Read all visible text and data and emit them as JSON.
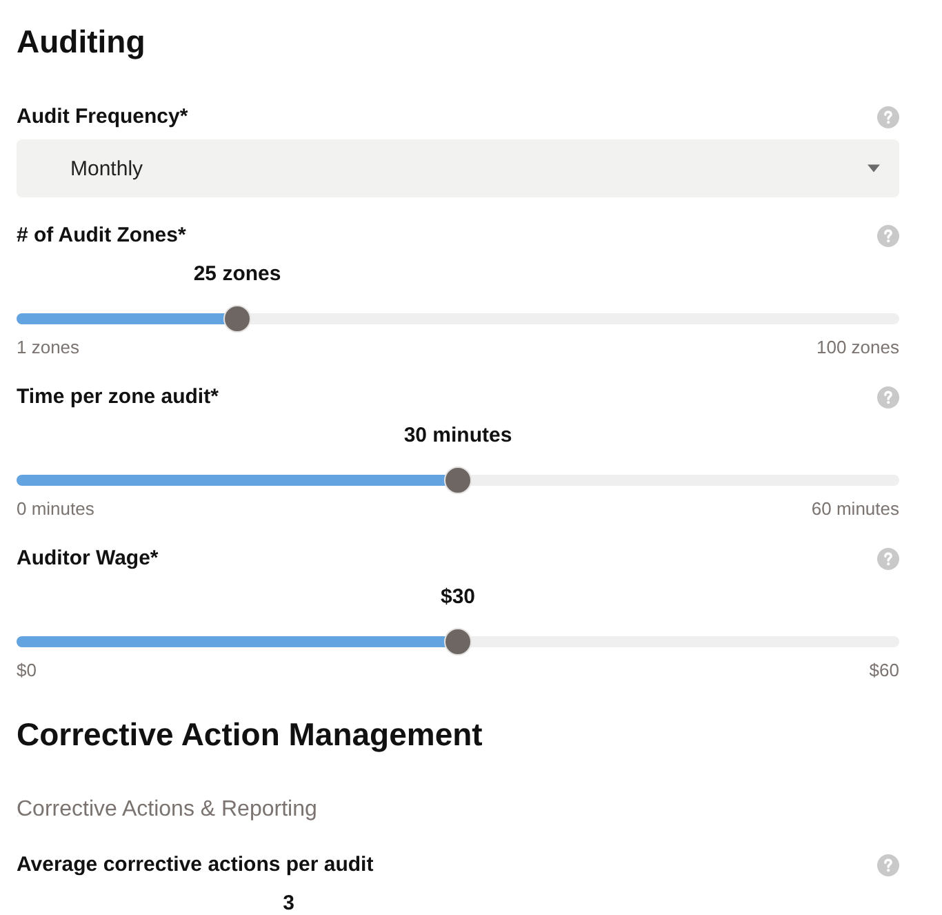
{
  "sections": [
    {
      "title": "Auditing",
      "fields": [
        {
          "kind": "select",
          "label": "Audit Frequency*",
          "value": "Monthly"
        },
        {
          "kind": "slider",
          "label": "# of Audit Zones*",
          "value": "25 zones",
          "level": 0.242,
          "min_label": "1 zones",
          "max_label": "100 zones"
        },
        {
          "kind": "slider",
          "label": "Time per zone audit*",
          "value": "30 minutes",
          "level": 0.5,
          "min_label": "0 minutes",
          "max_label": "60 minutes"
        },
        {
          "kind": "slider",
          "label": "Auditor Wage*",
          "value": "$30",
          "level": 0.5,
          "min_label": "$0",
          "max_label": "$60"
        }
      ]
    },
    {
      "title": "Corrective Action Management",
      "subtitle": "Corrective Actions & Reporting",
      "fields": [
        {
          "kind": "slider_head",
          "label": "Average corrective actions per audit",
          "value": "3",
          "level": 0.302
        }
      ]
    }
  ]
}
